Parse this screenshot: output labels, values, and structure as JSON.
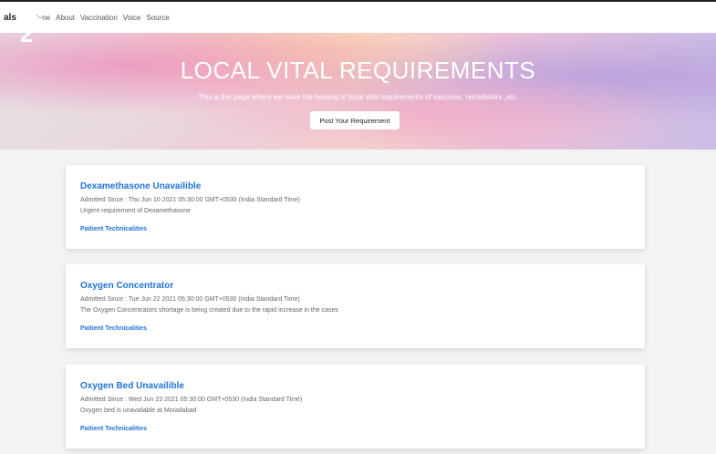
{
  "nav": {
    "brand": "als",
    "items": [
      "'~ne",
      "About",
      "Vaccination",
      "Voice",
      "Source"
    ]
  },
  "logo_glyph": "2",
  "hero": {
    "title": "LOCAL VITAL REQUIREMENTS",
    "subtitle": "This is the page where we have the hosting of local vital requirements of vaccines, remidisivirs ,etc.",
    "button_label": "Post Your Requirement"
  },
  "cards": [
    {
      "title": "Dexamethasone Unavailible",
      "admitted": "Admitted Since : Thu Jun 10 2021 05:30:00 GMT+0530 (India Standard Time)",
      "description": "Urgent requirement of Dexamethasone",
      "link": "Paitient Technicalities"
    },
    {
      "title": "Oxygen Concentrator",
      "admitted": "Admitted Since : Tue Jun 22 2021 05:30:00 GMT+0530 (India Standard Time)",
      "description": "The Oxygen Concentrators shortage is being created due to the rapid increase in the cases",
      "link": "Paitient Technicalities"
    },
    {
      "title": "Oxygen Bed Unavailible",
      "admitted": "Admitted Since : Wed Jun 23 2021 05:30:00 GMT+0530 (India Standard Time)",
      "description": "Oxygen bed is unavailable at Moradabad",
      "link": "Paitient Technicalities"
    }
  ]
}
